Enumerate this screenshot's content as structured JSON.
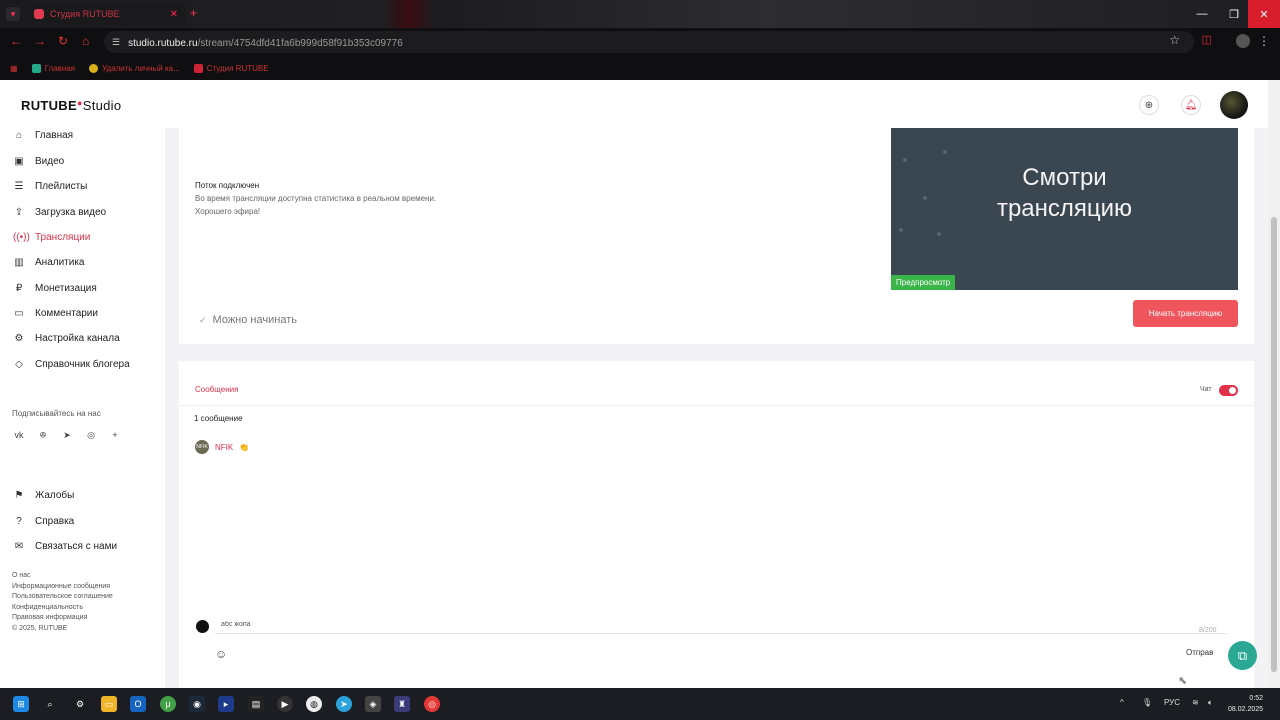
{
  "browser": {
    "tab_title": "Студия RUTUBE",
    "url_host": "studio.rutube.ru",
    "url_path": "/stream/4754dfd41fa6b999d58f91b353c09776",
    "bookmarks": [
      "Главная",
      "Удалить личный ка...",
      "Студия RUTUBE"
    ]
  },
  "header": {
    "logo_main": "RUTUBE",
    "logo_studio": "Studio"
  },
  "sidebar": {
    "items": [
      {
        "label": "Главная",
        "icon": "home-icon"
      },
      {
        "label": "Видео",
        "icon": "video-icon"
      },
      {
        "label": "Плейлисты",
        "icon": "playlist-icon"
      },
      {
        "label": "Загрузка видео",
        "icon": "upload-icon"
      },
      {
        "label": "Трансляции",
        "icon": "broadcast-icon"
      },
      {
        "label": "Аналитика",
        "icon": "analytics-icon"
      },
      {
        "label": "Монетизация",
        "icon": "money-icon"
      },
      {
        "label": "Комментарии",
        "icon": "comment-icon"
      },
      {
        "label": "Настройка канала",
        "icon": "settings-icon"
      },
      {
        "label": "Справочник блогера",
        "icon": "guide-icon"
      }
    ],
    "active_index": 4,
    "subscribe_label": "Подписывайтесь на нас",
    "socials": [
      "vk-icon",
      "ok-icon",
      "telegram-icon",
      "viber-icon",
      "plus-icon"
    ],
    "bottom_items": [
      {
        "label": "Жалобы",
        "icon": "flag-icon"
      },
      {
        "label": "Справка",
        "icon": "help-icon"
      },
      {
        "label": "Связаться с нами",
        "icon": "mail-icon"
      }
    ],
    "footer_links": [
      "О нас",
      "Информационные сообщения",
      "Пользовательское соглашение",
      "Конфиденциальность",
      "Правовая информация",
      "© 2025, RUTUBE"
    ]
  },
  "stream": {
    "status_title": "Поток подключен",
    "status_lines": [
      "Во время трансляции доступна статистика в реальном времени.",
      "Хорошего эфира!"
    ],
    "preview_text_1": "Смотри",
    "preview_text_2": "трансляцию",
    "preview_badge": "Предпросмотр",
    "ready_label": "Можно начинать",
    "start_button": "Начать трансляцию"
  },
  "chat": {
    "tab_label": "Сообщения",
    "chat_toggle_label": "Чат",
    "chat_enabled": true,
    "message_count": "1 сообщение",
    "messages": [
      {
        "user": "NFIK",
        "avatar_text": "NFIK",
        "text": "👏"
      }
    ],
    "input_value": "абс жопа",
    "char_count": "8/200",
    "send_label": "Отправ"
  },
  "taskbar": {
    "language": "РУС",
    "time": "0:52",
    "date": "08.02.2025"
  }
}
